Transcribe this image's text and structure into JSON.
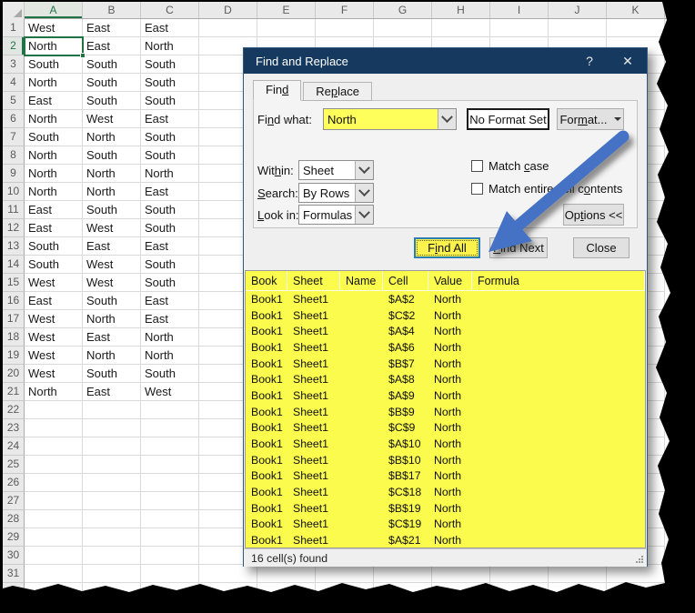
{
  "colors": {
    "excel_green": "#217346",
    "dialog_title_bar": "#163A5F",
    "highlight_yellow": "#FBFB4D",
    "arrow_blue": "#4472C4",
    "button_face": "#E1E1E1"
  },
  "spreadsheet": {
    "columns": [
      "A",
      "B",
      "C",
      "D",
      "E",
      "F",
      "G",
      "H",
      "I",
      "J",
      "K"
    ],
    "selected_column": "A",
    "selected_row": 2,
    "selected_cell": "A2",
    "rows_rendered": 32,
    "rows": [
      [
        "West",
        "East",
        "East"
      ],
      [
        "North",
        "East",
        "North"
      ],
      [
        "South",
        "South",
        "South"
      ],
      [
        "North",
        "South",
        "South"
      ],
      [
        "East",
        "South",
        "South"
      ],
      [
        "North",
        "West",
        "East"
      ],
      [
        "South",
        "North",
        "South"
      ],
      [
        "North",
        "South",
        "South"
      ],
      [
        "North",
        "North",
        "North"
      ],
      [
        "North",
        "North",
        "East"
      ],
      [
        "East",
        "South",
        "South"
      ],
      [
        "East",
        "West",
        "South"
      ],
      [
        "South",
        "East",
        "East"
      ],
      [
        "South",
        "West",
        "South"
      ],
      [
        "West",
        "West",
        "South"
      ],
      [
        "East",
        "South",
        "East"
      ],
      [
        "West",
        "North",
        "East"
      ],
      [
        "West",
        "East",
        "North"
      ],
      [
        "West",
        "North",
        "North"
      ],
      [
        "West",
        "South",
        "South"
      ],
      [
        "North",
        "East",
        "West"
      ]
    ]
  },
  "dialog": {
    "title": "Find and Replace",
    "help_glyph": "?",
    "close_glyph": "✕",
    "tabs": [
      {
        "pre": "Fin",
        "key": "d",
        "post": "",
        "active": true
      },
      {
        "pre": "Re",
        "key": "p",
        "post": "lace",
        "active": false
      }
    ],
    "find_what": {
      "label": {
        "pre": "Fi",
        "key": "n",
        "post": "d what:"
      },
      "value": "North",
      "format_preview": "No Format Set",
      "format_button": {
        "pre": "For",
        "key": "m",
        "post": "at..."
      }
    },
    "within": {
      "label": {
        "pre": "Wit",
        "key": "h",
        "post": "in:"
      },
      "value": "Sheet"
    },
    "search": {
      "label": {
        "pre": "",
        "key": "S",
        "post": "earch:"
      },
      "value": "By Rows"
    },
    "look_in": {
      "label": {
        "pre": "",
        "key": "L",
        "post": "ook in:"
      },
      "value": "Formulas"
    },
    "match_case": {
      "label": {
        "pre": "Match ",
        "key": "c",
        "post": "ase"
      },
      "checked": false
    },
    "match_entire": {
      "label": {
        "pre": "Match entire cell c",
        "key": "o",
        "post": "ntents"
      },
      "checked": false
    },
    "options_button": {
      "pre": "Op",
      "key": "t",
      "post": "ions <<"
    },
    "find_all_button": {
      "pre": "F",
      "key": "i",
      "post": "nd All"
    },
    "find_next_button": {
      "pre": "",
      "key": "F",
      "post": "ind Next"
    },
    "close_button": {
      "pre": "Close",
      "key": "",
      "post": ""
    },
    "results": {
      "headers": [
        "Book",
        "Sheet",
        "Name",
        "Cell",
        "Value",
        "Formula"
      ],
      "rows": [
        [
          "Book1",
          "Sheet1",
          "",
          "$A$2",
          "North",
          ""
        ],
        [
          "Book1",
          "Sheet1",
          "",
          "$C$2",
          "North",
          ""
        ],
        [
          "Book1",
          "Sheet1",
          "",
          "$A$4",
          "North",
          ""
        ],
        [
          "Book1",
          "Sheet1",
          "",
          "$A$6",
          "North",
          ""
        ],
        [
          "Book1",
          "Sheet1",
          "",
          "$B$7",
          "North",
          ""
        ],
        [
          "Book1",
          "Sheet1",
          "",
          "$A$8",
          "North",
          ""
        ],
        [
          "Book1",
          "Sheet1",
          "",
          "$A$9",
          "North",
          ""
        ],
        [
          "Book1",
          "Sheet1",
          "",
          "$B$9",
          "North",
          ""
        ],
        [
          "Book1",
          "Sheet1",
          "",
          "$C$9",
          "North",
          ""
        ],
        [
          "Book1",
          "Sheet1",
          "",
          "$A$10",
          "North",
          ""
        ],
        [
          "Book1",
          "Sheet1",
          "",
          "$B$10",
          "North",
          ""
        ],
        [
          "Book1",
          "Sheet1",
          "",
          "$B$17",
          "North",
          ""
        ],
        [
          "Book1",
          "Sheet1",
          "",
          "$C$18",
          "North",
          ""
        ],
        [
          "Book1",
          "Sheet1",
          "",
          "$B$19",
          "North",
          ""
        ],
        [
          "Book1",
          "Sheet1",
          "",
          "$C$19",
          "North",
          ""
        ],
        [
          "Book1",
          "Sheet1",
          "",
          "$A$21",
          "North",
          ""
        ]
      ],
      "status": "16 cell(s) found"
    }
  }
}
